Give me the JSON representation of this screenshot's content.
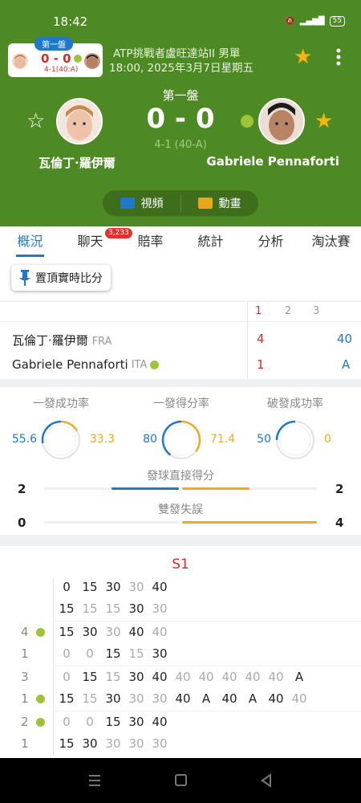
{
  "status": {
    "time": "18:42",
    "battery": "55"
  },
  "mini": {
    "set_tag": "第一盤",
    "score": "0 - 0",
    "game": "4-1(40:A)"
  },
  "match": {
    "tournament": "ATP挑戰者盧旺達站II 男單",
    "datetime": "18:00, 2025年3月7日星期五",
    "set_label": "第一盤",
    "score": "0 - 0",
    "game_score": "4-1 (40-A)",
    "p1": "瓦倫丁·羅伊爾",
    "p2": "Gabriele Pennaforti"
  },
  "media": {
    "video": "視頻",
    "anim": "動畫"
  },
  "tabs": [
    {
      "label": "概況"
    },
    {
      "label": "聊天",
      "badge": "3,233"
    },
    {
      "label": "賠率"
    },
    {
      "label": "統計"
    },
    {
      "label": "分析"
    },
    {
      "label": "淘汰賽"
    }
  ],
  "pin_label": "置頂實時比分",
  "scoreboard": {
    "headers": [
      "1",
      "2",
      "3"
    ],
    "rows": [
      {
        "name": "瓦倫丁·羅伊爾",
        "country": "FRA",
        "set1": "4",
        "game": "40"
      },
      {
        "name": "Gabriele Pennaforti",
        "country": "ITA",
        "set1": "1",
        "game": "A"
      }
    ]
  },
  "stats": {
    "circles": [
      {
        "label": "一發成功率",
        "left": "55.6",
        "right": "33.3",
        "left_pct": 55.6,
        "right_pct": 33.3
      },
      {
        "label": "一發得分率",
        "left": "80",
        "right": "71.4",
        "left_pct": 80,
        "right_pct": 71.4
      },
      {
        "label": "破發成功率",
        "left": "50",
        "right": "0",
        "left_pct": 50,
        "right_pct": 0
      }
    ],
    "bars": [
      {
        "label": "發球直接得分",
        "left": "2",
        "right": "2",
        "left_frac": 0.5,
        "right_frac": 0.5
      },
      {
        "label": "雙發失誤",
        "left": "0",
        "right": "4",
        "left_frac": 0,
        "right_frac": 1
      }
    ]
  },
  "pbp": {
    "title": "S1",
    "groups": [
      {
        "p1_games": "",
        "p2_games": "",
        "rows": [
          [
            "0",
            "15",
            "30",
            "30",
            "40"
          ],
          [
            "15",
            "15",
            "15",
            "30",
            "30"
          ]
        ],
        "dim": [
          [
            0,
            0,
            0,
            1,
            0
          ],
          [
            0,
            1,
            1,
            0,
            1
          ]
        ]
      },
      {
        "p1_games": "4",
        "p2_games": "1",
        "rows": [
          [
            "15",
            "30",
            "30",
            "40",
            "40"
          ],
          [
            "0",
            "0",
            "15",
            "15",
            "30"
          ]
        ],
        "dim": [
          [
            0,
            0,
            1,
            0,
            1
          ],
          [
            1,
            1,
            0,
            1,
            0
          ]
        ]
      },
      {
        "p1_games": "3",
        "p2_games": "1",
        "rows": [
          [
            "0",
            "15",
            "15",
            "30",
            "40",
            "40",
            "40",
            "40",
            "40",
            "40",
            "A"
          ],
          [
            "15",
            "15",
            "30",
            "30",
            "30",
            "40",
            "A",
            "40",
            "A",
            "40",
            "40"
          ]
        ],
        "dim": [
          [
            1,
            0,
            1,
            0,
            0,
            1,
            1,
            1,
            1,
            1,
            0
          ],
          [
            0,
            1,
            0,
            1,
            1,
            0,
            0,
            0,
            0,
            0,
            1
          ]
        ]
      },
      {
        "p1_games": "2",
        "p2_games": "1",
        "rows": [
          [
            "0",
            "0",
            "15",
            "30",
            "40"
          ],
          [
            "15",
            "30",
            "30",
            "30",
            "30"
          ]
        ],
        "dim": [
          [
            1,
            1,
            0,
            0,
            0
          ],
          [
            0,
            0,
            1,
            1,
            1
          ]
        ]
      }
    ]
  }
}
